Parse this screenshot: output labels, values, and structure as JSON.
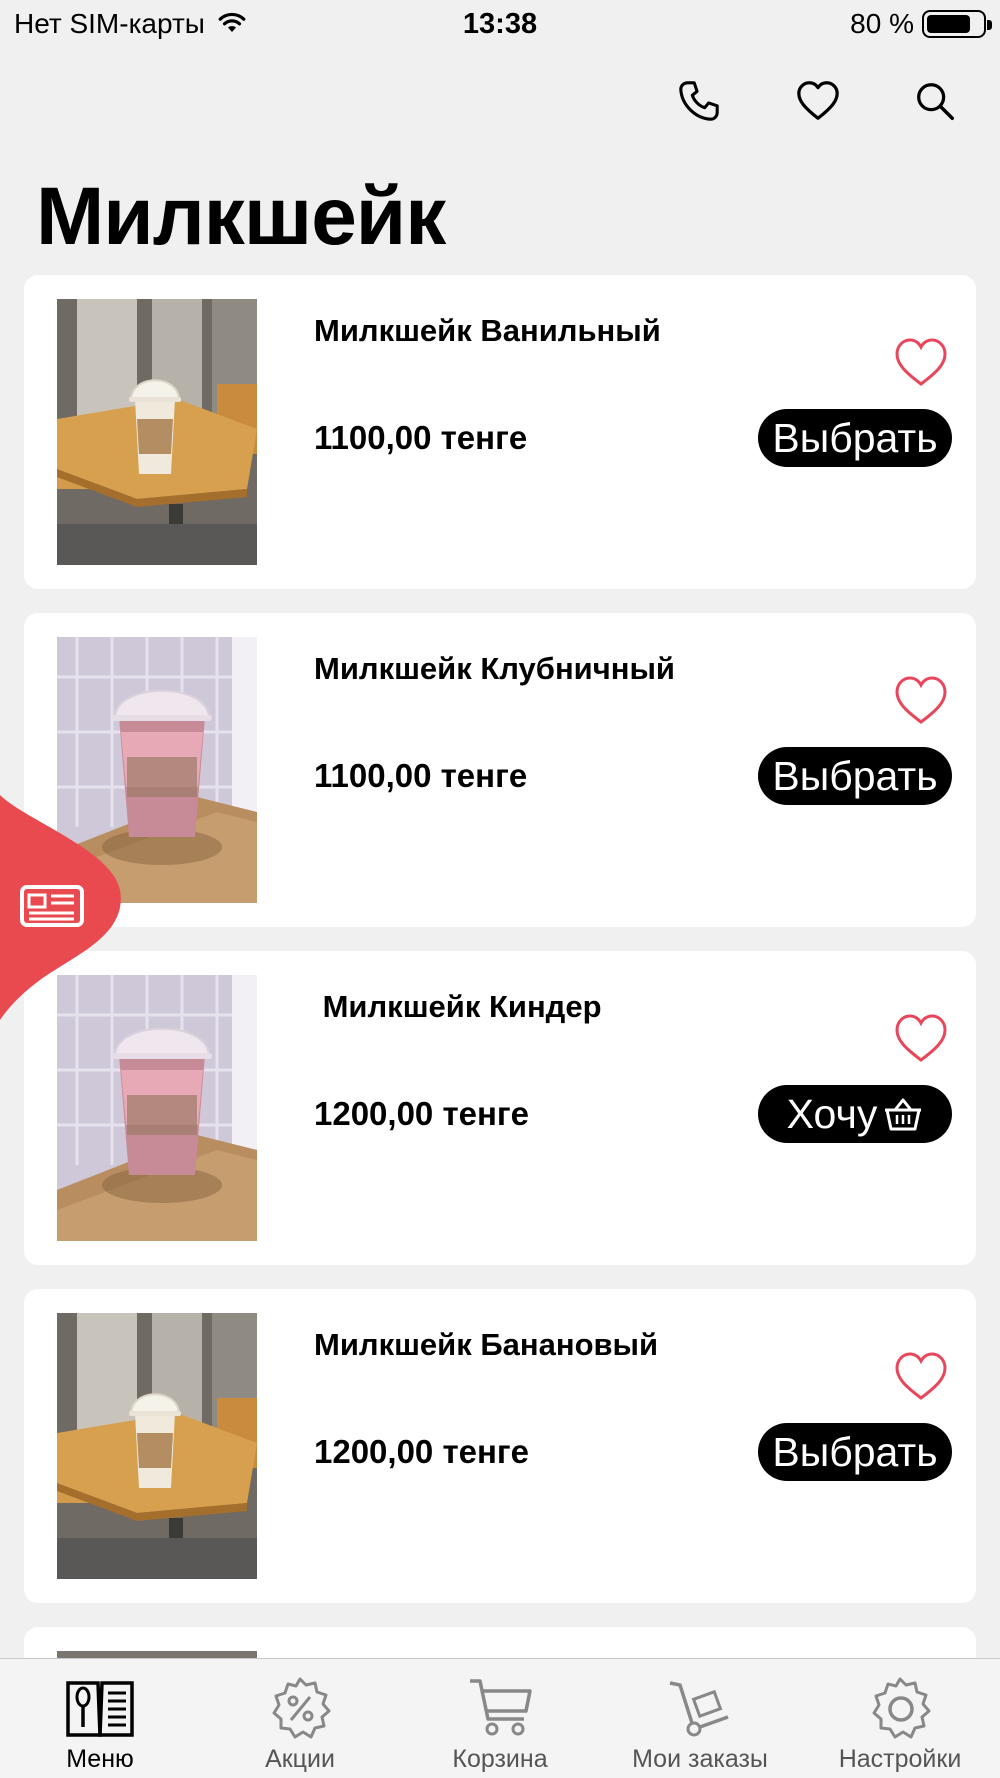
{
  "status_bar": {
    "carrier": "Нет SIM-карты",
    "time": "13:38",
    "battery_percent": "80 %",
    "battery_level": 0.8
  },
  "header": {
    "icons": [
      "phone-icon",
      "heart-icon",
      "search-icon"
    ]
  },
  "page": {
    "title": "Милкшейк"
  },
  "items": [
    {
      "name": "Милкшейк Ванильный",
      "price": "1100,00 тенге",
      "button": "Выбрать",
      "button_icon": null,
      "photo": "vanilla-cup"
    },
    {
      "name": "Милкшейк Клубничный",
      "price": "1100,00 тенге",
      "button": "Выбрать",
      "button_icon": null,
      "photo": "pink-cup"
    },
    {
      "name": " Милкшейк Киндер",
      "price": "1200,00 тенге",
      "button": "Хочу",
      "button_icon": "basket-icon",
      "photo": "pink-cup"
    },
    {
      "name": "Милкшейк Банановый",
      "price": "1200,00 тенге",
      "button": "Выбрать",
      "button_icon": null,
      "photo": "vanilla-cup"
    }
  ],
  "side_tab": {
    "icon": "newspaper-icon",
    "color": "#e84a4f"
  },
  "tab_bar": {
    "active_index": 0,
    "tabs": [
      {
        "label": "Меню",
        "icon": "menu-book-icon"
      },
      {
        "label": "Акции",
        "icon": "discount-gear-icon"
      },
      {
        "label": "Корзина",
        "icon": "cart-icon"
      },
      {
        "label": "Мои заказы",
        "icon": "hand-truck-icon"
      },
      {
        "label": "Настройки",
        "icon": "settings-icon"
      }
    ]
  },
  "colors": {
    "accent": "#e84a4f",
    "heart_outline": "#e8465a",
    "background": "#f0f0f0",
    "button": "#000000"
  }
}
